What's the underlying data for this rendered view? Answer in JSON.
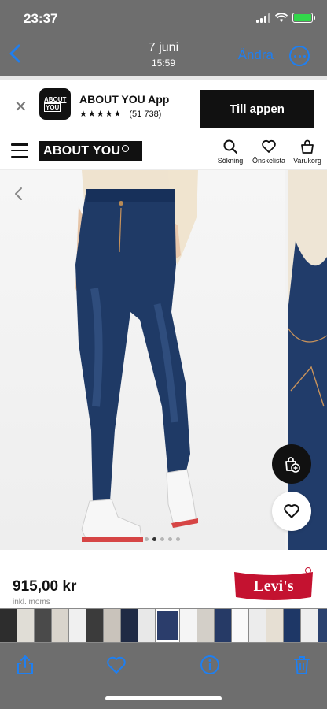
{
  "status_bar": {
    "time": "23:37"
  },
  "photos_nav": {
    "date": "7 juni",
    "time": "15:59",
    "edit_label": "Ändra"
  },
  "app_banner": {
    "title": "ABOUT YOU App",
    "logo_text_top": "ABOUT",
    "logo_text_bottom": "YOU",
    "stars": "★★★★★",
    "rating_count": "(51 738)",
    "cta_label": "Till appen"
  },
  "site_header": {
    "logo_text": "ABOUT YOU",
    "actions": [
      {
        "label": "Sökning",
        "icon": "search-icon"
      },
      {
        "label": "Önskelista",
        "icon": "heart-icon"
      },
      {
        "label": "Varukorg",
        "icon": "bag-icon"
      }
    ]
  },
  "gallery": {
    "image_count": 5,
    "active_index": 1
  },
  "product": {
    "price": "915,00 kr",
    "vat_note": "inkl. moms",
    "brand_text": "Levi's"
  },
  "colors": {
    "accent_blue": "#1f7ff0",
    "levis_red": "#c41230",
    "chrome_gray": "#6e6e6e"
  },
  "thumbnail_colors": [
    "#2d2d2d",
    "#e0ddd6",
    "#4a4a4a",
    "#d9d4cc",
    "#f0f0f0",
    "#3b3b3b",
    "#c9c3bb",
    "#1f2a44",
    "#e8e8e8",
    "#2b3d6b",
    "#f5f5f5",
    "#d3cfc8",
    "#263a66",
    "#fafafa",
    "#ececec",
    "#e6dfd3",
    "#1e3766",
    "#eeeeee",
    "#2a416e",
    "#f4f4f4",
    "#f7f7f7",
    "#cfcfcf",
    "#f1f1f1",
    "#e9e9e9",
    "#d8d3cb",
    "#3a3a3a",
    "#efefef",
    "#ececec",
    "#cfd8e6",
    "#e7e7e7",
    "#f3f3f3",
    "#2f2f2f",
    "#dddddd",
    "#8d6d54",
    "#fafafa",
    "#bdbdbd"
  ]
}
